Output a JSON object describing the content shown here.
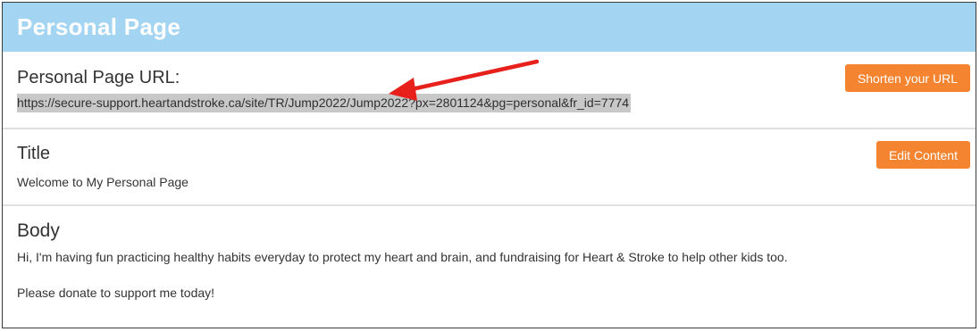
{
  "header": {
    "title": "Personal Page"
  },
  "url_section": {
    "label": "Personal Page URL:",
    "url": "https://secure-support.heartandstroke.ca/site/TR/Jump2022/Jump2022?px=2801124&pg=personal&fr_id=7774",
    "button_label": "Shorten your URL"
  },
  "title_section": {
    "label": "Title",
    "value": "Welcome to My Personal Page",
    "button_label": "Edit Content"
  },
  "body_section": {
    "label": "Body",
    "paragraph_1": "Hi, I'm having fun practicing healthy habits everyday to protect my heart and brain, and fundraising for Heart & Stroke to help other kids too.",
    "paragraph_2": "Please donate to support me today!"
  },
  "colors": {
    "header_bg": "#a3d5f3",
    "button_bg": "#f58430",
    "arrow": "#e8201c",
    "url_highlight": "#c8c8c8"
  }
}
